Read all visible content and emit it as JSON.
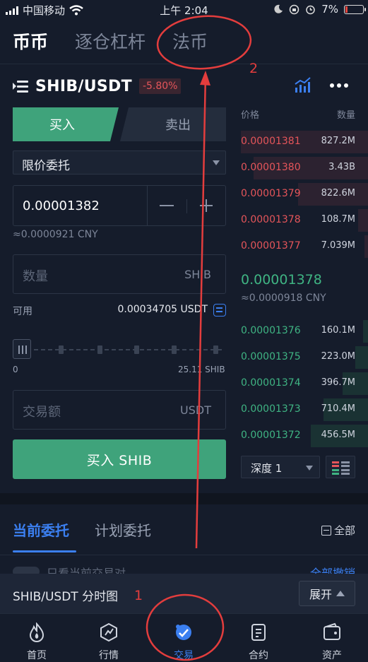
{
  "status_bar": {
    "carrier": "中国移动",
    "time": "上午 2:04",
    "battery": "7%"
  },
  "top_tabs": [
    {
      "label": "币币",
      "active": true
    },
    {
      "label": "逐仓杠杆",
      "active": false
    },
    {
      "label": "法币",
      "active": false
    }
  ],
  "pair": {
    "name": "SHIB/USDT",
    "change": "-5.80%"
  },
  "trade_form": {
    "buy_tab": "买入",
    "sell_tab": "卖出",
    "order_type": "限价委托",
    "price_value": "0.00001382",
    "price_cny": "≈0.0000921 CNY",
    "quantity_placeholder": "数量",
    "quantity_unit": "SHIB",
    "available_label": "可用",
    "available_value": "0.00034705 USDT",
    "slider_min": "0",
    "slider_max": "25.11 SHIB",
    "slider_level": 0,
    "amount_placeholder": "交易额",
    "amount_unit": "USDT",
    "buy_button": "买入 SHIB"
  },
  "orderbook": {
    "header_price": "价格",
    "header_amount": "数量",
    "asks": [
      {
        "price": "0.00001381",
        "amount": "827.2M",
        "depth": 1.0
      },
      {
        "price": "0.00001380",
        "amount": "3.43B",
        "depth": 0.9
      },
      {
        "price": "0.00001379",
        "amount": "822.6M",
        "depth": 0.55
      },
      {
        "price": "0.00001378",
        "amount": "108.7M",
        "depth": 0.08
      },
      {
        "price": "0.00001377",
        "amount": "7.039M",
        "depth": 0.03
      }
    ],
    "last_price": "0.00001378",
    "last_price_cny": "≈0.0000918 CNY",
    "bids": [
      {
        "price": "0.00001376",
        "amount": "160.1M",
        "depth": 0.04
      },
      {
        "price": "0.00001375",
        "amount": "223.0M",
        "depth": 0.1
      },
      {
        "price": "0.00001374",
        "amount": "396.7M",
        "depth": 0.2
      },
      {
        "price": "0.00001373",
        "amount": "710.4M",
        "depth": 0.35
      },
      {
        "price": "0.00001372",
        "amount": "456.5M",
        "depth": 0.45
      }
    ],
    "depth_select": "深度 1"
  },
  "orders": {
    "tabs": [
      {
        "label": "当前委托",
        "active": true
      },
      {
        "label": "计划委托",
        "active": false
      }
    ],
    "all_link": "全部",
    "filter_text": "只看当前交易对",
    "cancel_all": "全部撤销"
  },
  "chart_bar": {
    "label": "SHIB/USDT 分时图",
    "expand": "展开"
  },
  "bottom_nav": [
    {
      "label": "首页",
      "icon": "home-flame-icon",
      "active": false
    },
    {
      "label": "行情",
      "icon": "market-icon",
      "active": false
    },
    {
      "label": "交易",
      "icon": "trade-icon",
      "active": true
    },
    {
      "label": "合约",
      "icon": "contract-icon",
      "active": false
    },
    {
      "label": "资产",
      "icon": "wallet-icon",
      "active": false
    }
  ],
  "annotations": {
    "label_1": "1",
    "label_2": "2",
    "color": "#e33d3d"
  },
  "colors": {
    "buy_green": "#3fa37b",
    "sell_red": "#e5555a",
    "accent_blue": "#3b7ff0",
    "background": "#151c2b"
  }
}
